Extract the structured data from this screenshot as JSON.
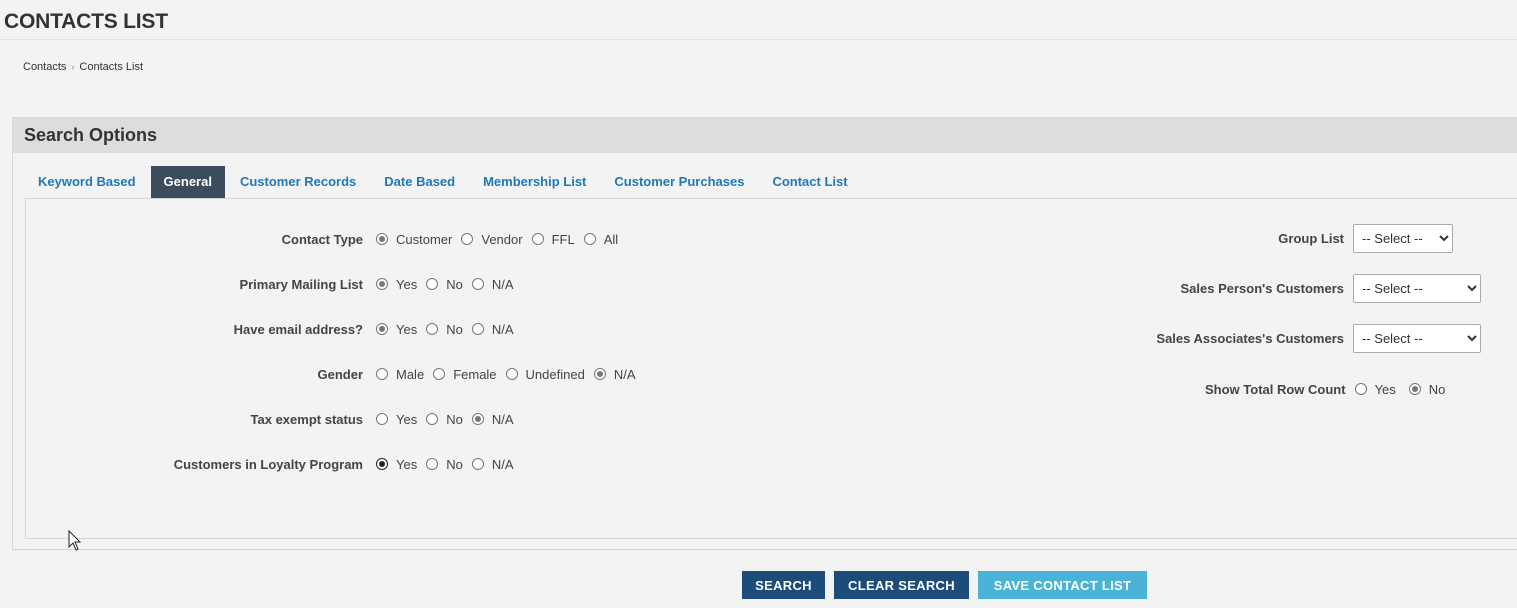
{
  "page": {
    "title": "CONTACTS LIST"
  },
  "breadcrumb": {
    "items": [
      "Contacts",
      "Contacts List"
    ],
    "separator": "›"
  },
  "panel": {
    "title": "Search Options"
  },
  "tabs": [
    {
      "label": "Keyword Based",
      "active": false
    },
    {
      "label": "General",
      "active": true
    },
    {
      "label": "Customer Records",
      "active": false
    },
    {
      "label": "Date Based",
      "active": false
    },
    {
      "label": "Membership List",
      "active": false
    },
    {
      "label": "Customer Purchases",
      "active": false
    },
    {
      "label": "Contact List",
      "active": false
    }
  ],
  "left_fields": [
    {
      "label": "Contact Type",
      "options": [
        "Customer",
        "Vendor",
        "FFL",
        "All"
      ],
      "selected": "Customer"
    },
    {
      "label": "Primary Mailing List",
      "options": [
        "Yes",
        "No",
        "N/A"
      ],
      "selected": "Yes"
    },
    {
      "label": "Have email address?",
      "options": [
        "Yes",
        "No",
        "N/A"
      ],
      "selected": "Yes"
    },
    {
      "label": "Gender",
      "options": [
        "Male",
        "Female",
        "Undefined",
        "N/A"
      ],
      "selected": "N/A"
    },
    {
      "label": "Tax exempt status",
      "options": [
        "Yes",
        "No",
        "N/A"
      ],
      "selected": "N/A"
    },
    {
      "label": "Customers in Loyalty Program",
      "options": [
        "Yes",
        "No",
        "N/A"
      ],
      "selected": "Yes"
    }
  ],
  "right_fields": {
    "group_list": {
      "label": "Group List",
      "value": "-- Select --"
    },
    "sales_person": {
      "label": "Sales Person's Customers",
      "value": "-- Select --"
    },
    "sales_associates": {
      "label": "Sales Associates's Customers",
      "value": "-- Select --"
    },
    "show_total": {
      "label": "Show Total Row Count",
      "options": [
        "Yes",
        "No"
      ],
      "selected": "No"
    }
  },
  "buttons": {
    "search": "SEARCH",
    "clear": "CLEAR SEARCH",
    "save": "SAVE CONTACT LIST"
  },
  "colors": {
    "tab_active_bg": "#3c4c5c",
    "tab_link": "#1f79b8",
    "button_primary": "#1d4b7a",
    "button_light": "#4bb3d6"
  },
  "icons": {
    "cursor": "mouse-pointer-icon"
  }
}
